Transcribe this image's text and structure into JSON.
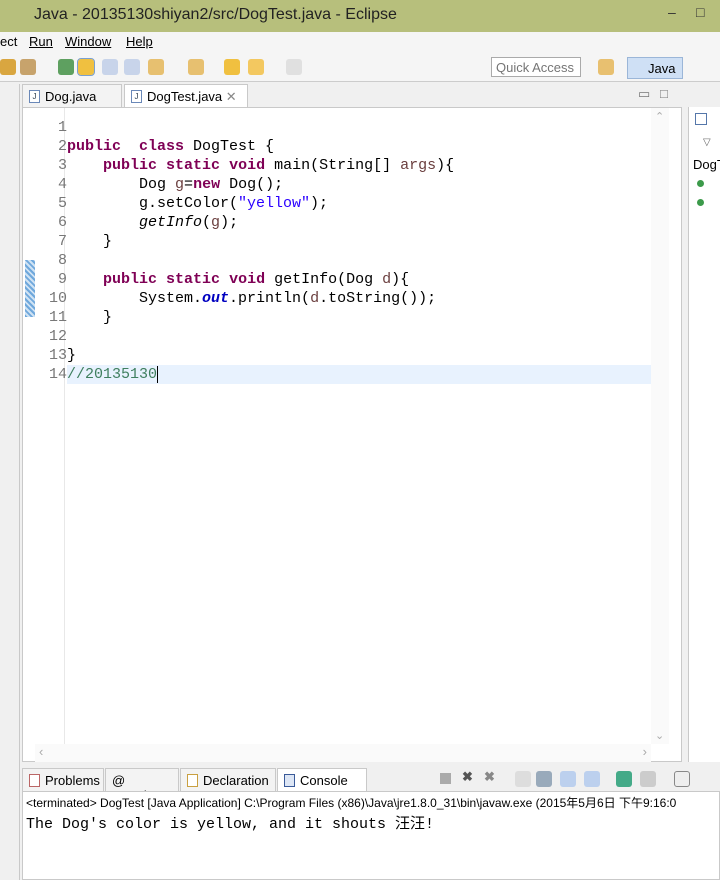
{
  "window": {
    "title": "Java - 20135130shiyan2/src/DogTest.java - Eclipse",
    "minimize": "–",
    "maximize": "□"
  },
  "menu": [
    {
      "label": "ect"
    },
    {
      "label": "Run"
    },
    {
      "label": "Window"
    },
    {
      "label": "Help"
    }
  ],
  "toolbar": {
    "quick_access_placeholder": "Quick Access",
    "perspective": "Java"
  },
  "editor_tabs": [
    {
      "label": "Dog.java",
      "active": false
    },
    {
      "label": "DogTest.java",
      "active": true,
      "close": "✕"
    }
  ],
  "editor": {
    "line_numbers": [
      "1",
      "2",
      "3",
      "4",
      "5",
      "6",
      "7",
      "8",
      "9",
      "10",
      "11",
      "12",
      "13",
      "14"
    ],
    "current_line": 14,
    "lines": [
      [],
      [
        [
          "kw",
          "public"
        ],
        [
          "",
          "  "
        ],
        [
          "kw",
          "class"
        ],
        [
          "",
          " DogTest {"
        ]
      ],
      [
        [
          "",
          "    "
        ],
        [
          "kw",
          "public"
        ],
        [
          "",
          " "
        ],
        [
          "kw",
          "static"
        ],
        [
          "",
          " "
        ],
        [
          "kw",
          "void"
        ],
        [
          "",
          " main(String[] "
        ],
        [
          "var",
          "args"
        ],
        [
          "",
          "){"
        ]
      ],
      [
        [
          "",
          "        Dog "
        ],
        [
          "var",
          "g"
        ],
        [
          "",
          "="
        ],
        [
          "kw",
          "new"
        ],
        [
          "",
          " Dog();"
        ]
      ],
      [
        [
          "",
          "        g.setColor("
        ],
        [
          "str",
          "\"yellow\""
        ],
        [
          "",
          ");"
        ]
      ],
      [
        [
          "",
          "        "
        ],
        [
          "it",
          "getInfo"
        ],
        [
          "",
          "("
        ],
        [
          "var",
          "g"
        ],
        [
          "",
          ");"
        ]
      ],
      [
        [
          "",
          "    }"
        ]
      ],
      [],
      [
        [
          "",
          "    "
        ],
        [
          "kw",
          "public"
        ],
        [
          "",
          " "
        ],
        [
          "kw",
          "static"
        ],
        [
          "",
          " "
        ],
        [
          "kw",
          "void"
        ],
        [
          "",
          " getInfo(Dog "
        ],
        [
          "var",
          "d"
        ],
        [
          "",
          "){"
        ]
      ],
      [
        [
          "",
          "        System."
        ],
        [
          "fld",
          "out"
        ],
        [
          "",
          ".println("
        ],
        [
          "var",
          "d"
        ],
        [
          "",
          ".toString());"
        ]
      ],
      [
        [
          "",
          "    }"
        ]
      ],
      [],
      [
        [
          "",
          "}"
        ]
      ],
      [
        [
          "cm",
          "//20135130"
        ]
      ]
    ]
  },
  "outline": {
    "label": "DogT"
  },
  "console_tabs": [
    {
      "label": "Problems"
    },
    {
      "label": "@ Javadoc"
    },
    {
      "label": "Declaration"
    },
    {
      "label": "Console",
      "active": true,
      "close": "✕"
    }
  ],
  "console": {
    "status": "<terminated> DogTest [Java Application] C:\\Program Files (x86)\\Java\\jre1.8.0_31\\bin\\javaw.exe (2015年5月6日 下午9:16:0",
    "output": "The Dog's color is yellow, and it shouts 汪汪!"
  },
  "colors": {
    "titlebar": "#b7bf7c",
    "keyword": "#7f0055",
    "string": "#2a00ff",
    "comment": "#3f7f5f",
    "field": "#0000c0"
  }
}
